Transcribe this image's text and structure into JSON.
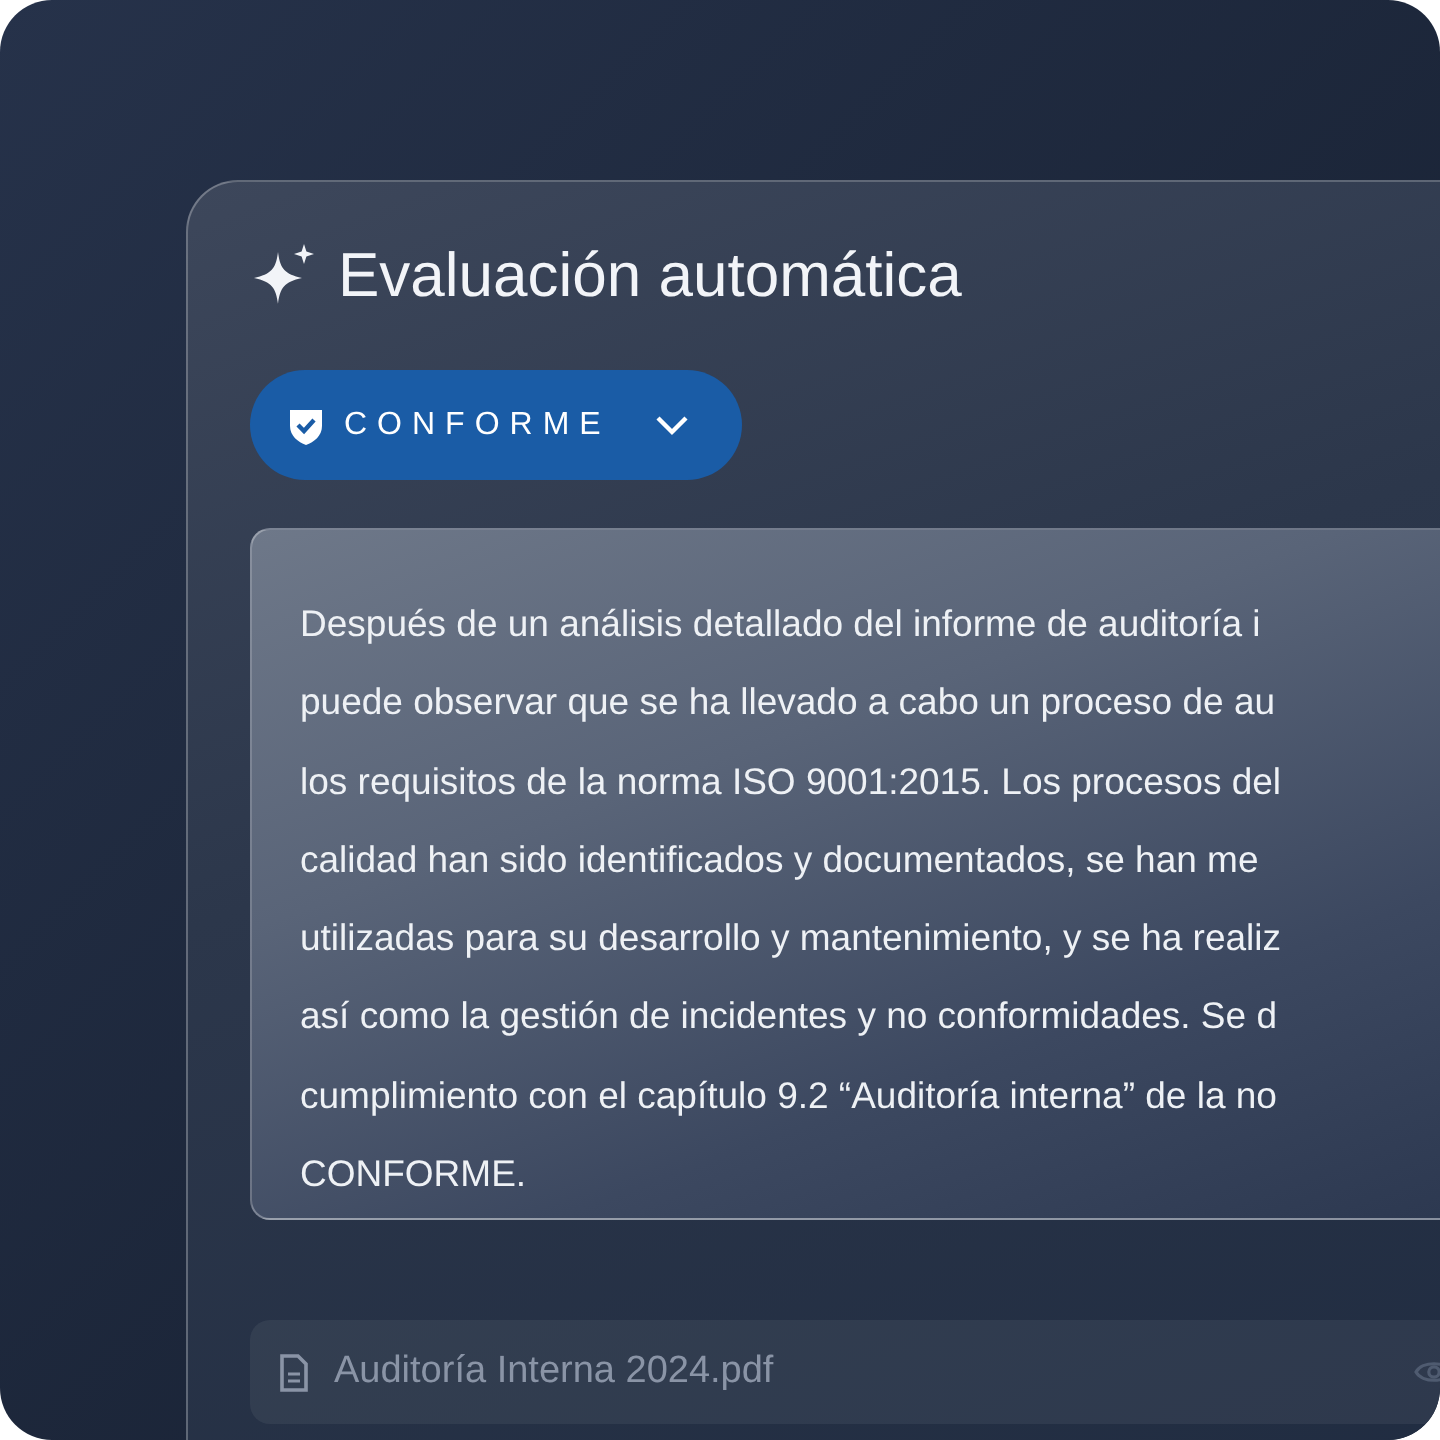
{
  "panel": {
    "title": "Evaluación automática"
  },
  "verdict": {
    "label": "CONFORME"
  },
  "summary": {
    "lines": [
      "Después de un análisis detallado del informe de auditoría i",
      "puede observar que se ha llevado a cabo un proceso de au",
      "los requisitos de la norma ISO 9001:2015. Los procesos del",
      "calidad han sido identificados y documentados, se han me",
      "utilizadas para su desarrollo y mantenimiento, y se ha realiz",
      "así como la gestión de incidentes y no conformidades. Se d",
      "cumplimiento con el capítulo 9.2 “Auditoría interna” de la no",
      "CONFORME."
    ]
  },
  "attachment": {
    "name": "Auditoría Interna 2024.pdf"
  }
}
